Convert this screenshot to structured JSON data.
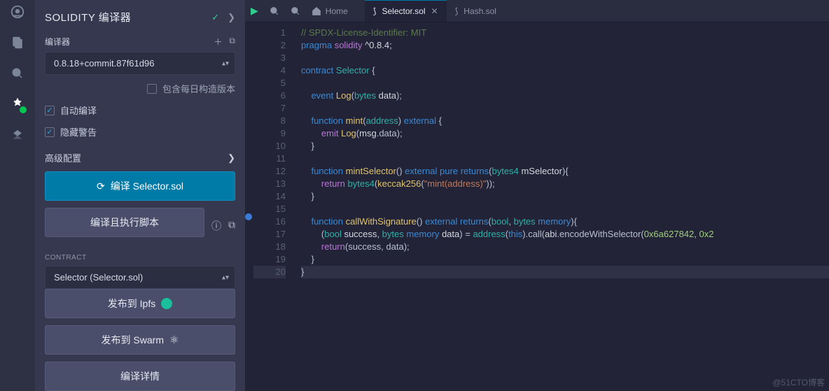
{
  "sidebar_icons": [
    "logo",
    "files",
    "search",
    "compiler",
    "deploy"
  ],
  "panel": {
    "title": "SOLIDITY 编译器",
    "compiler_label": "编译器",
    "compiler_select": "0.8.18+commit.87f61d96",
    "include_nightly": "包含每日构造版本",
    "auto_compile": "自动编译",
    "hide_warnings": "隐藏警告",
    "advanced": "高级配置",
    "compile_btn": "编译 Selector.sol",
    "run_btn": "编译且执行脚本",
    "contract_label": "CONTRACT",
    "contract_select": "Selector (Selector.sol)",
    "publish_ipfs": "发布到 Ipfs",
    "publish_swarm": "发布到 Swarm",
    "details": "编译详情"
  },
  "toolbar": {
    "home": "Home"
  },
  "tabs": [
    {
      "name": "Selector.sol",
      "active": true,
      "close": true
    },
    {
      "name": "Hash.sol",
      "active": false,
      "close": false
    }
  ],
  "code": {
    "lines": 20,
    "l1_comment": "// SPDX-License-Identifier: MIT",
    "l2_a": "pragma",
    "l2_b": "solidity",
    "l2_c": "^0.8.4;",
    "l4_a": "contract",
    "l4_b": "Selector",
    "l4_c": "{",
    "l6_a": "event",
    "l6_b": "Log",
    "l6_c": "(",
    "l6_d": "bytes",
    "l6_e": "data",
    "l6_f": ");",
    "l8_a": "function",
    "l8_b": "mint",
    "l8_c": "(",
    "l8_d": "address",
    "l8_e": ")",
    "l8_f": "external",
    "l8_g": "{",
    "l9_a": "emit",
    "l9_b": "Log",
    "l9_c": "(",
    "l9_d": "msg",
    "l9_e": ".data);",
    "l10_a": "}",
    "l12_a": "function",
    "l12_b": "mintSelector",
    "l12_c": "()",
    "l12_d": "external",
    "l12_e": "pure",
    "l12_f": "returns",
    "l12_g": "(",
    "l12_h": "bytes4",
    "l12_i": "mSelector",
    "l12_j": "){",
    "l13_a": "return",
    "l13_b": "bytes4",
    "l13_c": "(",
    "l13_d": "keccak256",
    "l13_e": "(",
    "l13_f": "\"mint(address)\"",
    "l13_g": "));",
    "l14_a": "}",
    "l16_a": "function",
    "l16_b": "callWithSignature",
    "l16_c": "()",
    "l16_d": "external",
    "l16_e": "returns",
    "l16_f": "(",
    "l16_g": "bool",
    "l16_h": ",",
    "l16_i": "bytes",
    "l16_j": "memory",
    "l16_k": "){",
    "l17_a": "(",
    "l17_b": "bool",
    "l17_c": "success",
    "l17_d": ",",
    "l17_e": "bytes",
    "l17_f": "memory",
    "l17_g": "data",
    "l17_h": ") =",
    "l17_i": "address",
    "l17_j": "(",
    "l17_k": "this",
    "l17_l": ").call(",
    "l17_m": "abi",
    "l17_n": ".encodeWithSelector(",
    "l17_o": "0x6a627842",
    "l17_p": ",",
    "l17_q": "0x2",
    "l18_a": "return",
    "l18_b": "(success, data);",
    "l19_a": "}",
    "l20_a": "}"
  },
  "watermark": "@51CTO博客"
}
